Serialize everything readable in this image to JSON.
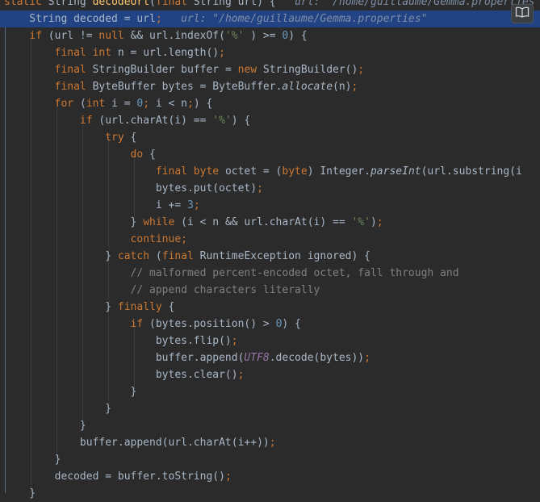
{
  "lines": [
    {
      "tokens": [
        [
          "kw",
          "static "
        ],
        [
          "",
          "String "
        ],
        [
          "fn",
          "decodeUrl"
        ],
        [
          "",
          "("
        ],
        [
          "kw",
          "final "
        ],
        [
          "",
          "String url) {   "
        ],
        [
          "hint",
          "url: \"/home/guillaume/Gemma.properties\""
        ]
      ]
    },
    {
      "tokens": [
        [
          "",
          "    String decoded = url"
        ],
        [
          "kw",
          ";"
        ],
        [
          "",
          "   "
        ],
        [
          "hint",
          "url: \"/home/guillaume/Gemma.properties\""
        ]
      ]
    },
    {
      "tokens": [
        [
          "",
          "    "
        ],
        [
          "kw",
          "if "
        ],
        [
          "",
          "(url != "
        ],
        [
          "kw",
          "null "
        ],
        [
          "",
          "&& url.indexOf("
        ],
        [
          "str",
          "'%'"
        ],
        [
          "",
          " ) >= "
        ],
        [
          "num",
          "0"
        ],
        [
          "",
          ") {"
        ]
      ]
    },
    {
      "tokens": [
        [
          "",
          "        "
        ],
        [
          "kw",
          "final int "
        ],
        [
          "",
          "n = url.length()"
        ],
        [
          "kw",
          ";"
        ]
      ]
    },
    {
      "tokens": [
        [
          "",
          "        "
        ],
        [
          "kw",
          "final "
        ],
        [
          "",
          "StringBuilder buffer = "
        ],
        [
          "kw",
          "new "
        ],
        [
          "",
          "StringBuilder()"
        ],
        [
          "kw",
          ";"
        ]
      ]
    },
    {
      "tokens": [
        [
          "",
          "        "
        ],
        [
          "kw",
          "final "
        ],
        [
          "",
          "ByteBuffer bytes = ByteBuffer."
        ],
        [
          "ital",
          "allocate"
        ],
        [
          "",
          "(n)"
        ],
        [
          "kw",
          ";"
        ]
      ]
    },
    {
      "tokens": [
        [
          "",
          "        "
        ],
        [
          "kw",
          "for "
        ],
        [
          "",
          "("
        ],
        [
          "kw",
          "int "
        ],
        [
          "",
          "i = "
        ],
        [
          "num",
          "0"
        ],
        [
          "kw",
          "; "
        ],
        [
          "",
          "i < n"
        ],
        [
          "kw",
          ";"
        ],
        [
          "",
          ") {"
        ]
      ]
    },
    {
      "tokens": [
        [
          "",
          "            "
        ],
        [
          "kw",
          "if "
        ],
        [
          "",
          "(url.charAt(i) == "
        ],
        [
          "str",
          "'%'"
        ],
        [
          "",
          ") {"
        ]
      ]
    },
    {
      "tokens": [
        [
          "",
          "                "
        ],
        [
          "kw",
          "try "
        ],
        [
          "",
          "{"
        ]
      ]
    },
    {
      "tokens": [
        [
          "",
          "                    "
        ],
        [
          "kw",
          "do "
        ],
        [
          "",
          "{"
        ]
      ]
    },
    {
      "tokens": [
        [
          "",
          "                        "
        ],
        [
          "kw",
          "final byte "
        ],
        [
          "",
          "octet = ("
        ],
        [
          "kw",
          "byte"
        ],
        [
          "",
          ") Integer."
        ],
        [
          "ital",
          "parseInt"
        ],
        [
          "",
          "(url.substring(i"
        ]
      ]
    },
    {
      "tokens": [
        [
          "",
          "                        bytes.put(octet)"
        ],
        [
          "kw",
          ";"
        ]
      ]
    },
    {
      "tokens": [
        [
          "",
          "                        i += "
        ],
        [
          "num",
          "3"
        ],
        [
          "kw",
          ";"
        ]
      ]
    },
    {
      "tokens": [
        [
          "",
          "                    } "
        ],
        [
          "kw",
          "while "
        ],
        [
          "",
          "(i < n && url.charAt(i) == "
        ],
        [
          "str",
          "'%'"
        ],
        [
          "",
          ")"
        ],
        [
          "kw",
          ";"
        ]
      ]
    },
    {
      "tokens": [
        [
          "",
          "                    "
        ],
        [
          "kw",
          "continue;"
        ]
      ]
    },
    {
      "tokens": [
        [
          "",
          "                } "
        ],
        [
          "kw",
          "catch "
        ],
        [
          "",
          "("
        ],
        [
          "kw",
          "final "
        ],
        [
          "",
          "RuntimeException ignored) {"
        ]
      ]
    },
    {
      "tokens": [
        [
          "",
          "                    "
        ],
        [
          "cmt",
          "// malformed percent-encoded octet, fall through and"
        ]
      ]
    },
    {
      "tokens": [
        [
          "",
          "                    "
        ],
        [
          "cmt",
          "// append characters literally"
        ]
      ]
    },
    {
      "tokens": [
        [
          "",
          "                } "
        ],
        [
          "kw",
          "finally "
        ],
        [
          "",
          "{"
        ]
      ]
    },
    {
      "tokens": [
        [
          "",
          "                    "
        ],
        [
          "kw",
          "if "
        ],
        [
          "",
          "(bytes.position() > "
        ],
        [
          "num",
          "0"
        ],
        [
          "",
          ") {"
        ]
      ]
    },
    {
      "tokens": [
        [
          "",
          "                        bytes.flip()"
        ],
        [
          "kw",
          ";"
        ]
      ]
    },
    {
      "tokens": [
        [
          "",
          "                        buffer.append("
        ],
        [
          "const",
          "UTF8"
        ],
        [
          "",
          ".decode(bytes))"
        ],
        [
          "kw",
          ";"
        ]
      ]
    },
    {
      "tokens": [
        [
          "",
          "                        bytes.clear()"
        ],
        [
          "kw",
          ";"
        ]
      ]
    },
    {
      "tokens": [
        [
          "",
          "                    }"
        ]
      ]
    },
    {
      "tokens": [
        [
          "",
          "                }"
        ]
      ]
    },
    {
      "tokens": [
        [
          "",
          "            }"
        ]
      ]
    },
    {
      "tokens": [
        [
          "",
          "            buffer.append(url.charAt(i++))"
        ],
        [
          "kw",
          ";"
        ]
      ]
    },
    {
      "tokens": [
        [
          "",
          "        }"
        ]
      ]
    },
    {
      "tokens": [
        [
          "",
          "        decoded = buffer.toString()"
        ],
        [
          "kw",
          ";"
        ]
      ]
    },
    {
      "tokens": [
        [
          "",
          "    }"
        ]
      ]
    }
  ],
  "current_line": 1,
  "toolbar": {
    "reader_mode_icon": "book-icon"
  }
}
